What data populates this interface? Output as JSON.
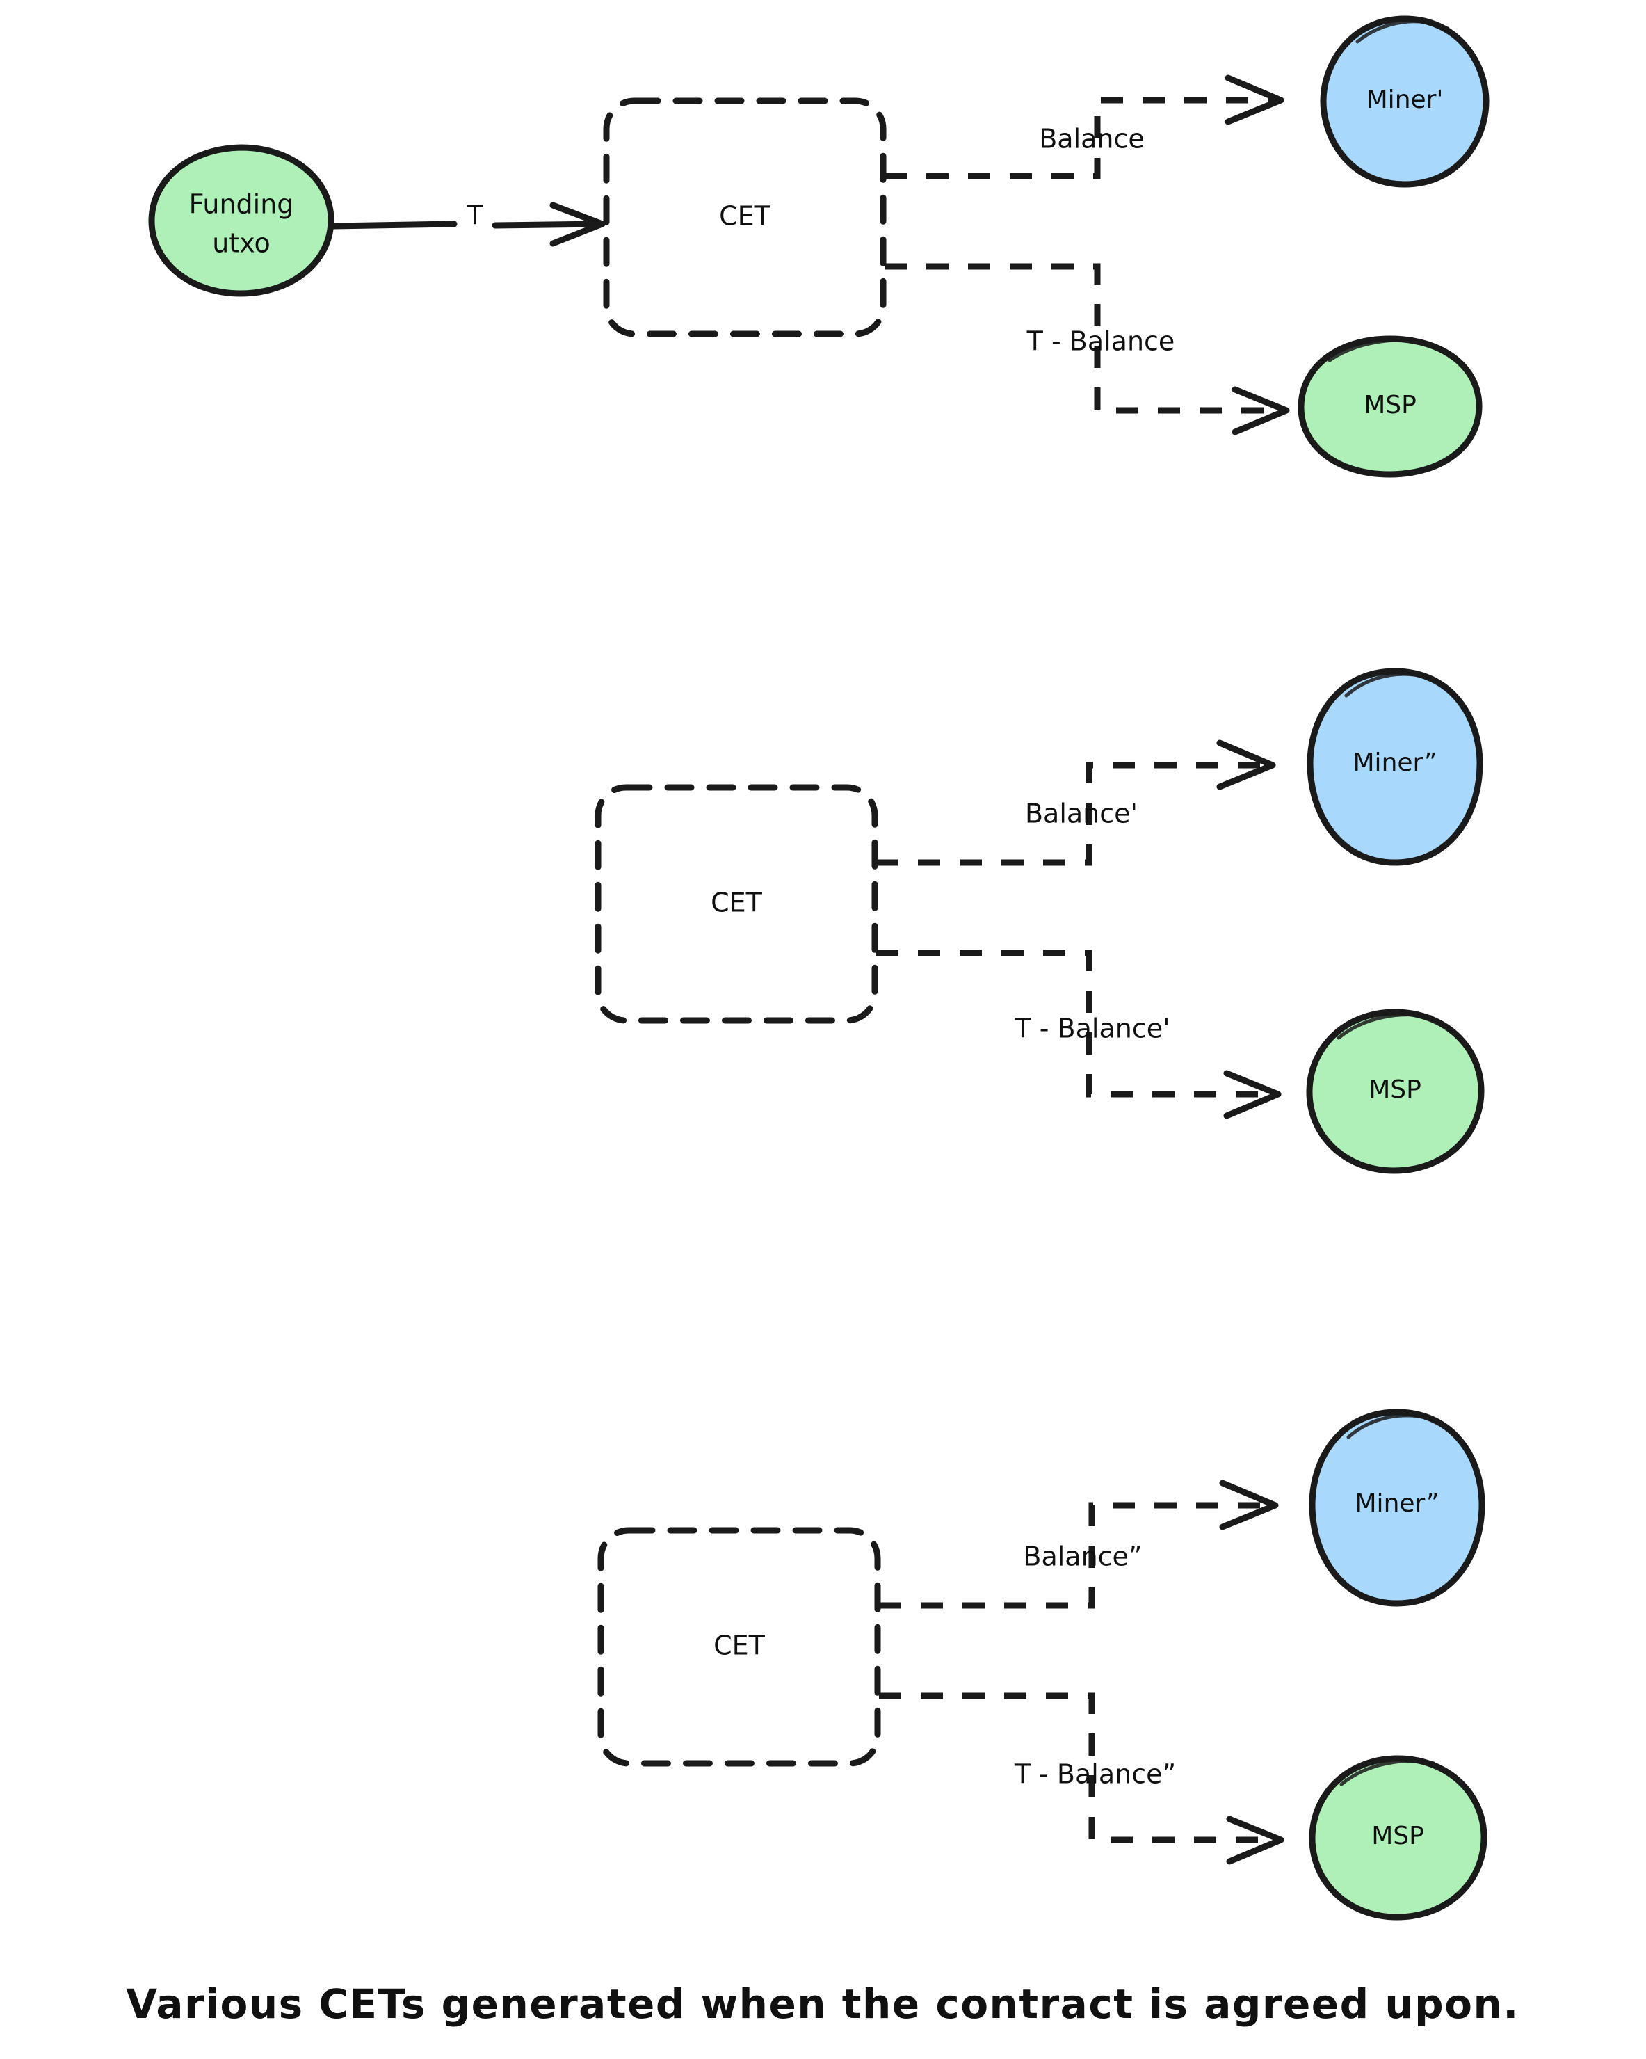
{
  "figure": {
    "caption": "Various CETs generated when the contract is agreed upon.",
    "colors": {
      "green_fill": "#aef0b8",
      "blue_fill": "#a8d8fc",
      "stroke": "#1a1a1a",
      "background": "#ffffff"
    }
  },
  "groups": [
    {
      "id": "cet-group-1",
      "funding_node": {
        "line1": "Funding",
        "line2": "utxo"
      },
      "funding_edge_label": "T",
      "cet_label": "CET",
      "outputs": [
        {
          "edge_label": "Balance",
          "target": "Miner'",
          "target_kind": "miner"
        },
        {
          "edge_label": "T - Balance",
          "target": "MSP",
          "target_kind": "msp"
        }
      ]
    },
    {
      "id": "cet-group-2",
      "funding_node": null,
      "funding_edge_label": null,
      "cet_label": "CET",
      "outputs": [
        {
          "edge_label": "Balance'",
          "target": "Miner”",
          "target_kind": "miner"
        },
        {
          "edge_label": "T - Balance'",
          "target": "MSP",
          "target_kind": "msp"
        }
      ]
    },
    {
      "id": "cet-group-3",
      "funding_node": null,
      "funding_edge_label": null,
      "cet_label": "CET",
      "outputs": [
        {
          "edge_label": "Balance”",
          "target": "Miner”",
          "target_kind": "miner"
        },
        {
          "edge_label": "T - Balance”",
          "target": "MSP",
          "target_kind": "msp"
        }
      ]
    }
  ]
}
